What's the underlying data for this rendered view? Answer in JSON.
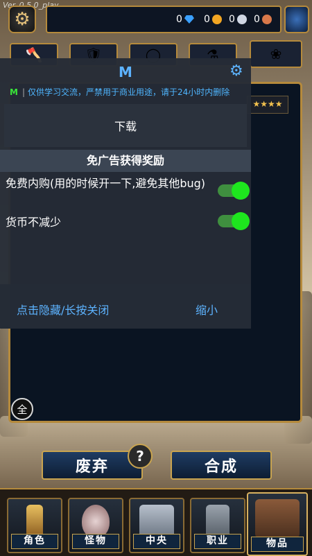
{
  "version": "Ver_0.5.0_play",
  "currency": [
    {
      "icon": "diamond-icon",
      "value": "0",
      "color": "#3aa0ff"
    },
    {
      "icon": "gold-coin-icon",
      "value": "0",
      "color": "#f2a623"
    },
    {
      "icon": "silver-coin-icon",
      "value": "0",
      "color": "#cfd6e3"
    },
    {
      "icon": "copper-coin-icon",
      "value": "0",
      "color": "#d8784a"
    }
  ],
  "category_tabs": [
    {
      "icon": "axe-icon"
    },
    {
      "icon": "armor-icon"
    },
    {
      "icon": "ring-icon"
    },
    {
      "icon": "potion-icon"
    },
    {
      "icon": "materials-icon"
    }
  ],
  "rating_stars": "★★★★",
  "all_button": "全",
  "overlay": {
    "title": "M",
    "notice_badge": "M",
    "notice": "仅供学习交流，严禁用于商业用途，请于24小时内删除",
    "download": "下载",
    "section_title": "免广告获得奖励",
    "options": [
      {
        "label": "免费内购(用的时候开一下,避免其他bug)",
        "enabled": true
      },
      {
        "label": "货币不减少",
        "enabled": true
      }
    ],
    "hide_link": "点击隐藏/长按关闭",
    "minimize_link": "缩小"
  },
  "actions": {
    "discard": "废弃",
    "help": "?",
    "combine": "合成"
  },
  "nav": [
    {
      "label": "角色",
      "icon": "character-icon",
      "active": false
    },
    {
      "label": "怪物",
      "icon": "monster-egg-icon",
      "active": false
    },
    {
      "label": "中央",
      "icon": "castle-icon",
      "active": false
    },
    {
      "label": "职业",
      "icon": "job-statue-icon",
      "active": false
    },
    {
      "label": "物品",
      "icon": "shop-house-icon",
      "active": true
    }
  ],
  "colors": {
    "gold_border": "#b58a3c",
    "accent_blue": "#5db3ff",
    "toggle_on": "#1ee61e"
  }
}
